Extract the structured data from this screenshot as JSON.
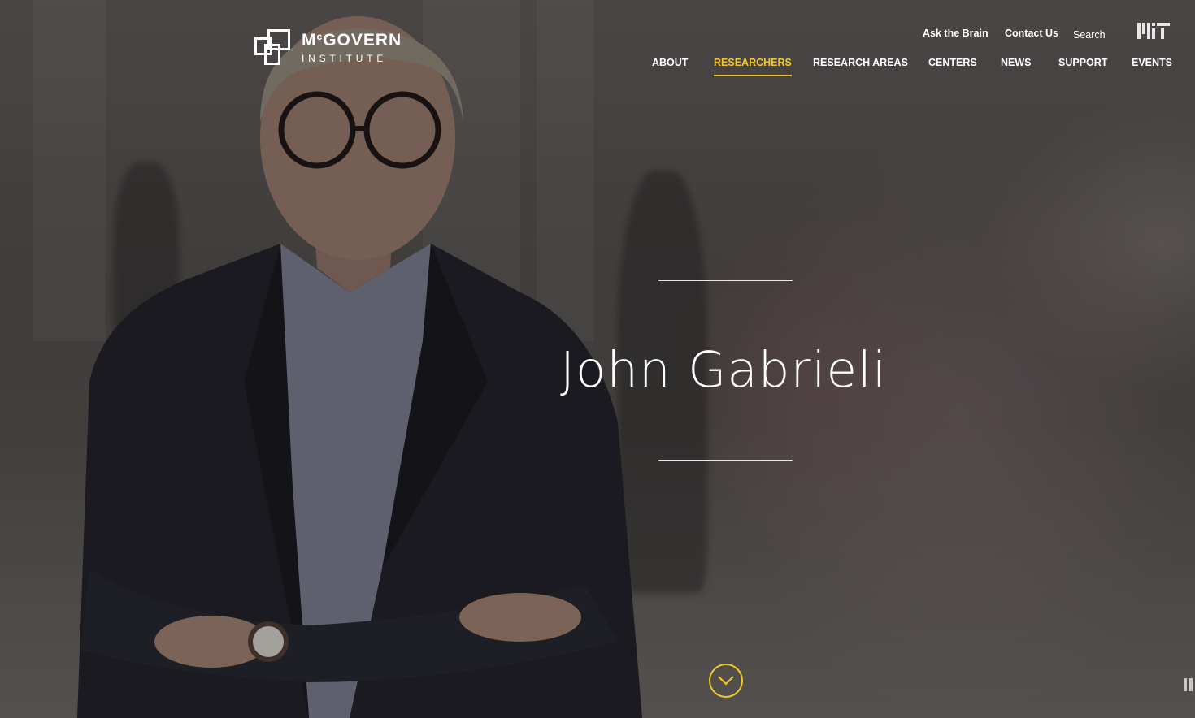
{
  "site": {
    "logo_name": "MCGOVERN",
    "logo_name_sup": "c",
    "logo_name_prefix": "M",
    "logo_name_rest": "GOVERN",
    "logo_sub": "INSTITUTE"
  },
  "utility_nav": [
    {
      "label": "Ask the Brain"
    },
    {
      "label": "Contact Us"
    },
    {
      "label": "Search"
    }
  ],
  "main_nav": [
    {
      "label": "ABOUT",
      "active": false
    },
    {
      "label": "RESEARCHERS",
      "active": true
    },
    {
      "label": "RESEARCH AREAS",
      "active": false
    },
    {
      "label": "CENTERS",
      "active": false
    },
    {
      "label": "NEWS",
      "active": false
    },
    {
      "label": "SUPPORT",
      "active": false
    },
    {
      "label": "EVENTS",
      "active": false
    }
  ],
  "hero": {
    "title": "John Gabrieli"
  },
  "colors": {
    "accent": "#f0c62b",
    "text": "#ffffff"
  },
  "icons": {
    "scroll": "chevron-down-icon",
    "media": "pause-icon",
    "partner": "mit-logo-icon"
  }
}
